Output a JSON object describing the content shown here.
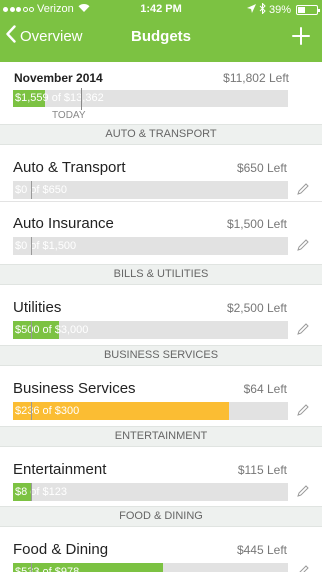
{
  "status_bar": {
    "carrier": "Verizon",
    "time": "1:42 PM",
    "battery": "39%",
    "battery_level": 0.39
  },
  "nav": {
    "back_label": "Overview",
    "title": "Budgets"
  },
  "summary": {
    "month": "November 2014",
    "left": "$11,802 Left",
    "bar_text": "$1,559 of $13,362",
    "fraction": 0.117,
    "today_fraction": 0.47,
    "today_label": "TODAY"
  },
  "sections": [
    {
      "header": "AUTO & TRANSPORT",
      "budgets": [
        {
          "name": "Auto & Transport",
          "left": "$650 Left",
          "bar_text": "$0 of $650",
          "fraction": 0.0,
          "fill_color": "#7cc242",
          "text_color": "#ffffff"
        },
        {
          "name": "Auto Insurance",
          "left": "$1,500 Left",
          "bar_text": "$0 of $1,500",
          "fraction": 0.0,
          "fill_color": "#7cc242",
          "text_color": "#ffffff"
        }
      ]
    },
    {
      "header": "BILLS & UTILITIES",
      "budgets": [
        {
          "name": "Utilities",
          "left": "$2,500 Left",
          "bar_text": "$500 of $3,000",
          "fraction": 0.167,
          "fill_color": "#7cc242",
          "text_color": "#ffffff"
        }
      ]
    },
    {
      "header": "BUSINESS SERVICES",
      "budgets": [
        {
          "name": "Business Services",
          "left": "$64 Left",
          "bar_text": "$236 of $300",
          "fraction": 0.787,
          "fill_color": "#fbbd33",
          "text_color": "#ffffff"
        }
      ]
    },
    {
      "header": "ENTERTAINMENT",
      "budgets": [
        {
          "name": "Entertainment",
          "left": "$115 Left",
          "bar_text": "$8 of $123",
          "fraction": 0.065,
          "fill_color": "#7cc242",
          "text_color": "#ffffff"
        }
      ]
    },
    {
      "header": "FOOD & DINING",
      "budgets": [
        {
          "name": "Food & Dining",
          "left": "$445 Left",
          "bar_text": "$533 of $978",
          "fraction": 0.545,
          "fill_color": "#7cc242",
          "text_color": "#ffffff"
        }
      ]
    }
  ],
  "colors": {
    "accent": "#7cc242",
    "warning": "#fbbd33",
    "track": "#e2e2e2",
    "section_bg": "#eef1ef"
  },
  "icons": {
    "back": "chevron-left-icon",
    "add": "plus-icon",
    "edit": "pencil-icon",
    "wifi": "wifi-icon",
    "location": "location-arrow-icon",
    "bluetooth": "bluetooth-icon",
    "battery": "battery-icon"
  }
}
